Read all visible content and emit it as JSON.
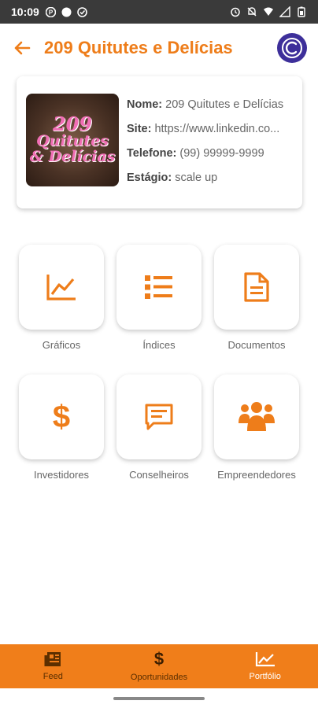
{
  "status_bar": {
    "time": "10:09",
    "left_icons": [
      "p-icon",
      "circle-icon",
      "shield-icon"
    ],
    "right_icons": [
      "alarm-icon",
      "mute-icon",
      "wifi-icon",
      "signal-icon",
      "battery-icon"
    ]
  },
  "header": {
    "title": "209 Quitutes e Delícias"
  },
  "company": {
    "logo_line1": "209",
    "logo_line2": "Quitutes",
    "logo_line3": "& Delícias",
    "name_label": "Nome:",
    "name_value": "209 Quitutes e Delícias",
    "site_label": "Site:",
    "site_value": "https://www.linkedin.co...",
    "phone_label": "Telefone:",
    "phone_value": "(99) 99999-9999",
    "stage_label": "Estágio:",
    "stage_value": "scale up"
  },
  "menu": [
    {
      "label": "Gráficos",
      "icon": "chart-icon"
    },
    {
      "label": "Índices",
      "icon": "list-icon"
    },
    {
      "label": "Documentos",
      "icon": "document-icon"
    },
    {
      "label": "Investidores",
      "icon": "dollar-icon"
    },
    {
      "label": "Conselheiros",
      "icon": "chat-icon"
    },
    {
      "label": "Empreendedores",
      "icon": "group-icon"
    }
  ],
  "bottom_nav": [
    {
      "label": "Feed",
      "icon": "newspaper-icon",
      "active": false
    },
    {
      "label": "Oportunidades",
      "icon": "dollar-icon",
      "active": false
    },
    {
      "label": "Portfólio",
      "icon": "chart-icon",
      "active": true
    }
  ],
  "colors": {
    "accent": "#ee7d1a",
    "nav_bg": "#f07e1a",
    "brand_logo": "#3d2f9a"
  }
}
